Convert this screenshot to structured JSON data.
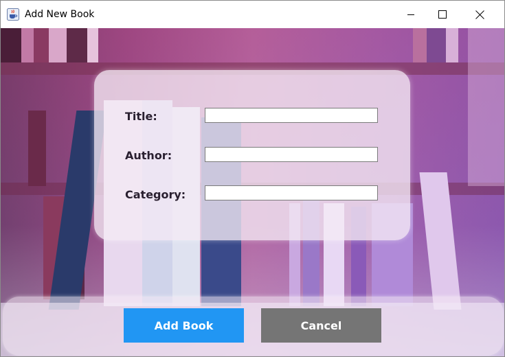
{
  "window": {
    "title": "Add New Book",
    "app_icon": "java-cup-icon",
    "controls": [
      "minimize-icon",
      "maximize-icon",
      "close-icon"
    ]
  },
  "form": {
    "title_label": "Title:",
    "title_value": "",
    "author_label": "Author:",
    "author_value": "",
    "category_label": "Category:",
    "category_value": ""
  },
  "actions": {
    "add_label": "Add Book",
    "cancel_label": "Cancel"
  },
  "colors": {
    "add_button": "#2196f3",
    "cancel_button": "#757575"
  }
}
